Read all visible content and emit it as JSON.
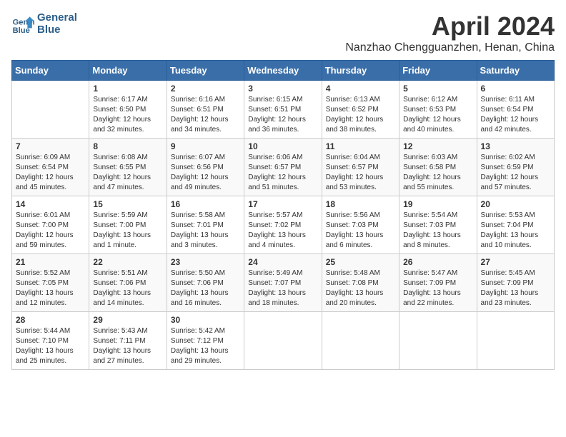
{
  "logo": {
    "line1": "General",
    "line2": "Blue"
  },
  "title": "April 2024",
  "location": "Nanzhao Chengguanzhen, Henan, China",
  "weekdays": [
    "Sunday",
    "Monday",
    "Tuesday",
    "Wednesday",
    "Thursday",
    "Friday",
    "Saturday"
  ],
  "weeks": [
    [
      {
        "day": "",
        "info": ""
      },
      {
        "day": "1",
        "info": "Sunrise: 6:17 AM\nSunset: 6:50 PM\nDaylight: 12 hours\nand 32 minutes."
      },
      {
        "day": "2",
        "info": "Sunrise: 6:16 AM\nSunset: 6:51 PM\nDaylight: 12 hours\nand 34 minutes."
      },
      {
        "day": "3",
        "info": "Sunrise: 6:15 AM\nSunset: 6:51 PM\nDaylight: 12 hours\nand 36 minutes."
      },
      {
        "day": "4",
        "info": "Sunrise: 6:13 AM\nSunset: 6:52 PM\nDaylight: 12 hours\nand 38 minutes."
      },
      {
        "day": "5",
        "info": "Sunrise: 6:12 AM\nSunset: 6:53 PM\nDaylight: 12 hours\nand 40 minutes."
      },
      {
        "day": "6",
        "info": "Sunrise: 6:11 AM\nSunset: 6:54 PM\nDaylight: 12 hours\nand 42 minutes."
      }
    ],
    [
      {
        "day": "7",
        "info": "Sunrise: 6:09 AM\nSunset: 6:54 PM\nDaylight: 12 hours\nand 45 minutes."
      },
      {
        "day": "8",
        "info": "Sunrise: 6:08 AM\nSunset: 6:55 PM\nDaylight: 12 hours\nand 47 minutes."
      },
      {
        "day": "9",
        "info": "Sunrise: 6:07 AM\nSunset: 6:56 PM\nDaylight: 12 hours\nand 49 minutes."
      },
      {
        "day": "10",
        "info": "Sunrise: 6:06 AM\nSunset: 6:57 PM\nDaylight: 12 hours\nand 51 minutes."
      },
      {
        "day": "11",
        "info": "Sunrise: 6:04 AM\nSunset: 6:57 PM\nDaylight: 12 hours\nand 53 minutes."
      },
      {
        "day": "12",
        "info": "Sunrise: 6:03 AM\nSunset: 6:58 PM\nDaylight: 12 hours\nand 55 minutes."
      },
      {
        "day": "13",
        "info": "Sunrise: 6:02 AM\nSunset: 6:59 PM\nDaylight: 12 hours\nand 57 minutes."
      }
    ],
    [
      {
        "day": "14",
        "info": "Sunrise: 6:01 AM\nSunset: 7:00 PM\nDaylight: 12 hours\nand 59 minutes."
      },
      {
        "day": "15",
        "info": "Sunrise: 5:59 AM\nSunset: 7:00 PM\nDaylight: 13 hours\nand 1 minute."
      },
      {
        "day": "16",
        "info": "Sunrise: 5:58 AM\nSunset: 7:01 PM\nDaylight: 13 hours\nand 3 minutes."
      },
      {
        "day": "17",
        "info": "Sunrise: 5:57 AM\nSunset: 7:02 PM\nDaylight: 13 hours\nand 4 minutes."
      },
      {
        "day": "18",
        "info": "Sunrise: 5:56 AM\nSunset: 7:03 PM\nDaylight: 13 hours\nand 6 minutes."
      },
      {
        "day": "19",
        "info": "Sunrise: 5:54 AM\nSunset: 7:03 PM\nDaylight: 13 hours\nand 8 minutes."
      },
      {
        "day": "20",
        "info": "Sunrise: 5:53 AM\nSunset: 7:04 PM\nDaylight: 13 hours\nand 10 minutes."
      }
    ],
    [
      {
        "day": "21",
        "info": "Sunrise: 5:52 AM\nSunset: 7:05 PM\nDaylight: 13 hours\nand 12 minutes."
      },
      {
        "day": "22",
        "info": "Sunrise: 5:51 AM\nSunset: 7:06 PM\nDaylight: 13 hours\nand 14 minutes."
      },
      {
        "day": "23",
        "info": "Sunrise: 5:50 AM\nSunset: 7:06 PM\nDaylight: 13 hours\nand 16 minutes."
      },
      {
        "day": "24",
        "info": "Sunrise: 5:49 AM\nSunset: 7:07 PM\nDaylight: 13 hours\nand 18 minutes."
      },
      {
        "day": "25",
        "info": "Sunrise: 5:48 AM\nSunset: 7:08 PM\nDaylight: 13 hours\nand 20 minutes."
      },
      {
        "day": "26",
        "info": "Sunrise: 5:47 AM\nSunset: 7:09 PM\nDaylight: 13 hours\nand 22 minutes."
      },
      {
        "day": "27",
        "info": "Sunrise: 5:45 AM\nSunset: 7:09 PM\nDaylight: 13 hours\nand 23 minutes."
      }
    ],
    [
      {
        "day": "28",
        "info": "Sunrise: 5:44 AM\nSunset: 7:10 PM\nDaylight: 13 hours\nand 25 minutes."
      },
      {
        "day": "29",
        "info": "Sunrise: 5:43 AM\nSunset: 7:11 PM\nDaylight: 13 hours\nand 27 minutes."
      },
      {
        "day": "30",
        "info": "Sunrise: 5:42 AM\nSunset: 7:12 PM\nDaylight: 13 hours\nand 29 minutes."
      },
      {
        "day": "",
        "info": ""
      },
      {
        "day": "",
        "info": ""
      },
      {
        "day": "",
        "info": ""
      },
      {
        "day": "",
        "info": ""
      }
    ]
  ]
}
